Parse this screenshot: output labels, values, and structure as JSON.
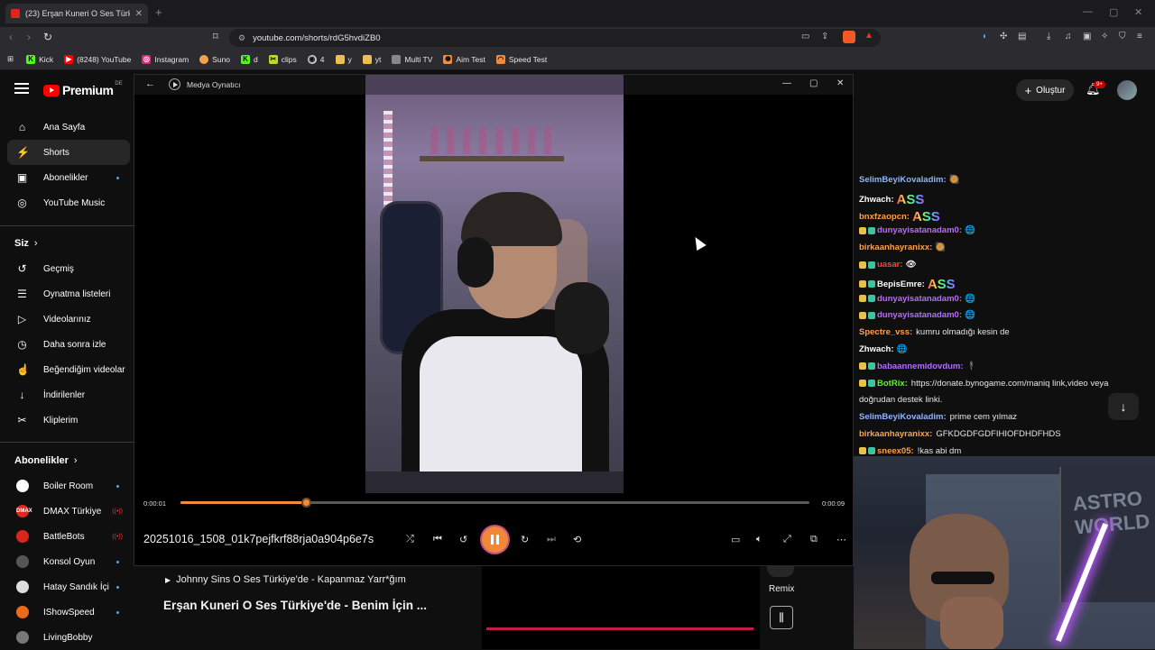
{
  "browser": {
    "tab_title": "(23) Erşan Kuneri O Ses Türkiye'd...",
    "url": "youtube.com/shorts/rdG5hvdiZB0",
    "bookmarks": [
      {
        "label": "Kick",
        "icon": "K",
        "color": "#53fc18"
      },
      {
        "label": "(8248) YouTube",
        "icon": "▶",
        "color": "#ff0000"
      },
      {
        "label": "Instagram",
        "icon": "◎",
        "color": "#d62976"
      },
      {
        "label": "Suno",
        "icon": "●",
        "color": "#f4a24a"
      },
      {
        "label": "d",
        "icon": "K",
        "color": "#53fc18"
      },
      {
        "label": "clips",
        "icon": "✂",
        "color": "#b6e01d"
      },
      {
        "label": "4",
        "icon": "◉",
        "color": "#cccccc"
      },
      {
        "label": "y",
        "icon": "▮",
        "color": "#e9c04a"
      },
      {
        "label": "yt",
        "icon": "▮",
        "color": "#e9c04a"
      },
      {
        "label": "Multi TV",
        "icon": "▮",
        "color": "#888888"
      },
      {
        "label": "Aim Test",
        "icon": "✺",
        "color": "#f28c3c"
      },
      {
        "label": "Speed Test",
        "icon": "◠",
        "color": "#f28c3c"
      }
    ]
  },
  "youtube": {
    "logo_text": "Premium",
    "region": "DE",
    "create_label": "Oluştur",
    "notif_badge": "9+",
    "sidebar": {
      "main": [
        {
          "label": "Ana Sayfa",
          "icon": "home-icon",
          "glyph": "⌂"
        },
        {
          "label": "Shorts",
          "icon": "shorts-icon",
          "glyph": "▶"
        },
        {
          "label": "Abonelikler",
          "icon": "subscriptions-icon",
          "glyph": "▣"
        },
        {
          "label": "YouTube Music",
          "icon": "music-icon",
          "glyph": "◎"
        }
      ],
      "you_header": "Siz",
      "you": [
        {
          "label": "Geçmiş",
          "icon": "history-icon",
          "glyph": "↺"
        },
        {
          "label": "Oynatma listeleri",
          "icon": "playlist-icon",
          "glyph": "☰"
        },
        {
          "label": "Videolarınız",
          "icon": "your-videos-icon",
          "glyph": "▷"
        },
        {
          "label": "Daha sonra izle",
          "icon": "watch-later-icon",
          "glyph": "◷"
        },
        {
          "label": "Beğendiğim videolar",
          "icon": "like-icon",
          "glyph": "👍"
        },
        {
          "label": "İndirilenler",
          "icon": "download-icon",
          "glyph": "↓"
        },
        {
          "label": "Kliplerim",
          "icon": "clips-icon",
          "glyph": "✂"
        }
      ],
      "subs_header": "Abonelikler",
      "subs": [
        {
          "label": "Boiler Room",
          "color": "#ffffff",
          "status": "dot"
        },
        {
          "label": "DMAX Türkiye",
          "color": "#e3261c",
          "status": "live",
          "avatar_text": "DMAX"
        },
        {
          "label": "BattleBots",
          "color": "#d9261c",
          "status": "live"
        },
        {
          "label": "Konsol Oyun",
          "color": "#555555",
          "status": "dot"
        },
        {
          "label": "Hatay Sandık İçi",
          "color": "#dddddd",
          "status": "dot"
        },
        {
          "label": "IShowSpeed",
          "color": "#e96b1c",
          "status": "dot"
        },
        {
          "label": "LivingBobby",
          "color": "#777777",
          "status": "none"
        }
      ]
    },
    "related_title": "Johnny Sins O Ses Türkiye'de - Kapanmaz Yarr*ğım",
    "main_title": "Erşan Kuneri O Ses Türkiye'de - Benim İçin ...",
    "remix_label": "Remix"
  },
  "player": {
    "app_name": "Medya Oynatıcı",
    "time_current": "0:00:01",
    "time_total": "0:00:09",
    "progress": 0.2,
    "filename": "20251016_1508_01k7pejfkrf88rja0a904p6e7s"
  },
  "chat": {
    "messages": [
      {
        "user": "SelimBeyiKovaladim:",
        "color": "#8fb5ff",
        "text": "",
        "emote": "🥘"
      },
      {
        "user": "Zhwach:",
        "color": "#ffffff",
        "text": "",
        "emote": "ASS"
      },
      {
        "user": "bnxfzaopcn:",
        "color": "#ffa14a",
        "text": "",
        "emote": "ASS"
      },
      {
        "user": "dunyayisatanadam0:",
        "color": "#b56cff",
        "text": "",
        "emote": "🌐",
        "badges": true
      },
      {
        "user": "birkaanhayranixx:",
        "color": "#ffa14a",
        "text": "",
        "emote": "🥘"
      },
      {
        "user": "uasar:",
        "color": "#ff4040",
        "text": "",
        "emote": "👁",
        "badges": true
      },
      {
        "user": "BepisEmre:",
        "color": "#ffffff",
        "text": "",
        "emote": "ASS",
        "badges": true
      },
      {
        "user": "dunyayisatanadam0:",
        "color": "#b56cff",
        "text": "",
        "emote": "🌐",
        "badges": true
      },
      {
        "user": "dunyayisatanadam0:",
        "color": "#b56cff",
        "text": "",
        "emote": "🌐",
        "badges": true
      },
      {
        "user": "Spectre_vss:",
        "color": "#ffa14a",
        "text": "kumru olmadığı kesin de",
        "emote": ""
      },
      {
        "user": "Zhwach:",
        "color": "#ffffff",
        "text": "",
        "emote": "🌐"
      },
      {
        "user": "babaannemidovdum:",
        "color": "#b56cff",
        "text": "",
        "emote": "🕴",
        "badges": true
      },
      {
        "user": "BotRix:",
        "color": "#53fc18",
        "text": "https://donate.bynogame.com/maniq link,video veya",
        "emote": "",
        "badges": true
      },
      {
        "user": "",
        "color": "#ffffff",
        "text": "doğrudan destek linki.",
        "emote": ""
      },
      {
        "user": "SelimBeyiKovaladim:",
        "color": "#8fb5ff",
        "text": "prime cem yılmaz",
        "emote": ""
      },
      {
        "user": "birkaanhayranixx:",
        "color": "#ffa14a",
        "text": "GFKDGDFGDFIHIOFDHDFHDS",
        "emote": ""
      },
      {
        "user": "sneex05:",
        "color": "#ffa14a",
        "text": "!kas abi dm",
        "emote": "",
        "badges": true
      }
    ]
  },
  "webcam": {
    "poster_text": "ASTRO WORLD"
  }
}
